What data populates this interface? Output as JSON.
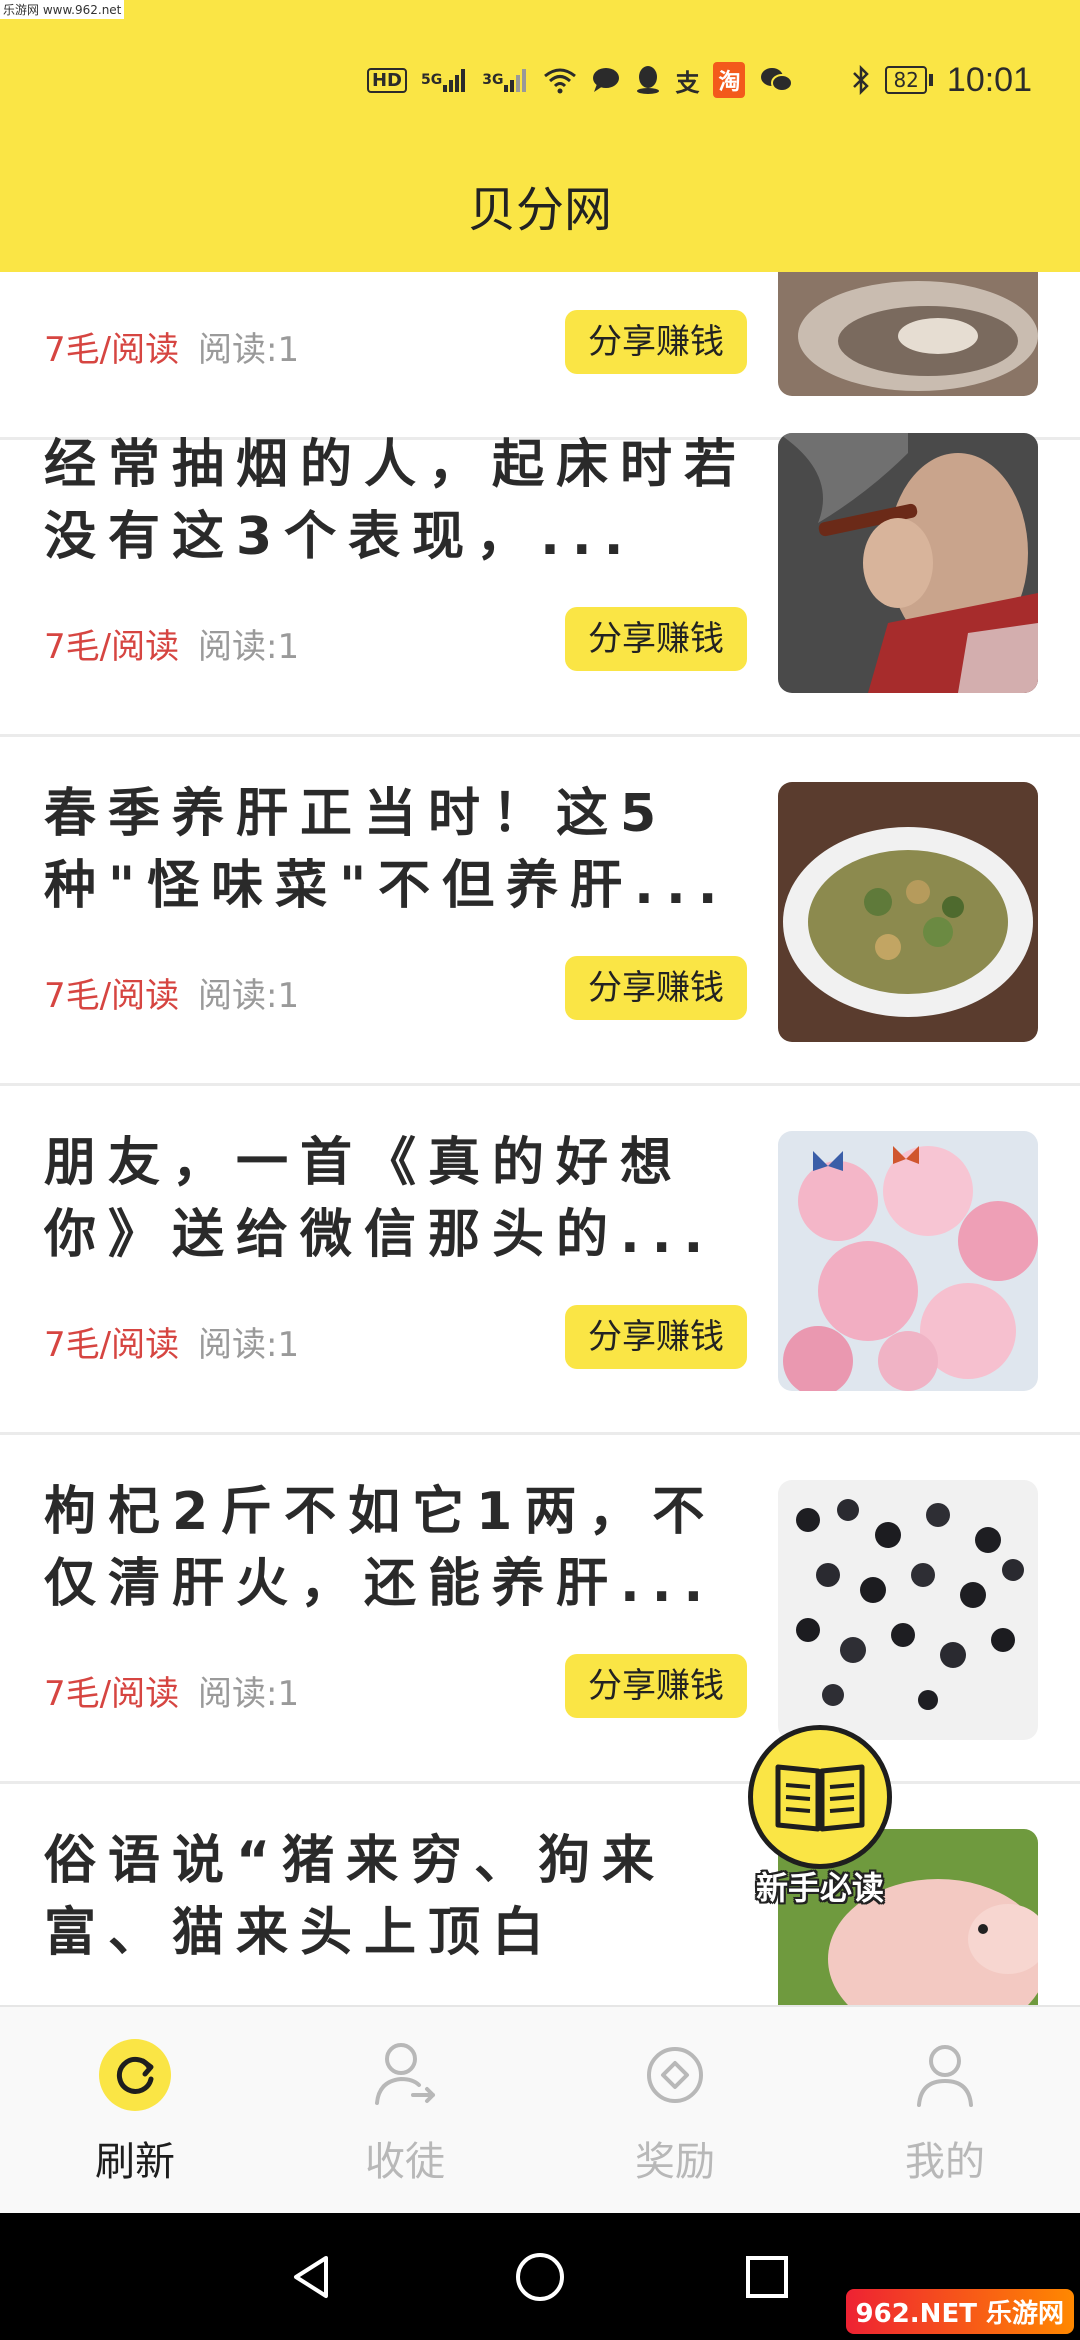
{
  "watermark": {
    "top": "乐游网 www.962.net",
    "bottom": "962.NET 乐游网"
  },
  "status_bar": {
    "hd": "HD",
    "signal_5g": "5G",
    "signal_3g": "3G",
    "alipay": "支",
    "taobao": "淘",
    "battery": "82",
    "time": "10:01"
  },
  "header": {
    "title": "贝分网"
  },
  "articles": [
    {
      "title": "",
      "price": "7毛/阅读",
      "reads": "阅读:1",
      "share_label": "分享赚钱",
      "thumb": "oyster"
    },
    {
      "title": "经常抽烟的人，起床时若没有这3个表现，...",
      "price": "7毛/阅读",
      "reads": "阅读:1",
      "share_label": "分享赚钱",
      "thumb": "smoker"
    },
    {
      "title": "春季养肝正当时！这5种\"怪味菜\"不但养肝...",
      "price": "7毛/阅读",
      "reads": "阅读:1",
      "share_label": "分享赚钱",
      "thumb": "dish"
    },
    {
      "title": "朋友，一首《真的好想你》送给微信那头的...",
      "price": "7毛/阅读",
      "reads": "阅读:1",
      "share_label": "分享赚钱",
      "thumb": "blossom"
    },
    {
      "title": "枸杞2斤不如它1两，不仅清肝火，还能养肝...",
      "price": "7毛/阅读",
      "reads": "阅读:1",
      "share_label": "分享赚钱",
      "thumb": "berries"
    },
    {
      "title": "俗语说“猪来穷、狗来富、猫来头上顶白布”...",
      "price": "",
      "reads": "",
      "share_label": "",
      "thumb": "piglet"
    }
  ],
  "fab": {
    "label": "新手必读",
    "icon": "book-icon"
  },
  "tabs": [
    {
      "label": "刷新",
      "icon": "refresh-icon",
      "active": true
    },
    {
      "label": "收徒",
      "icon": "user-share-icon",
      "active": false
    },
    {
      "label": "奖励",
      "icon": "diamond-icon",
      "active": false
    },
    {
      "label": "我的",
      "icon": "person-icon",
      "active": false
    }
  ],
  "colors": {
    "accent": "#fae545",
    "price": "#d64541",
    "muted": "#9a9a9a",
    "title": "#2a2a2a"
  }
}
